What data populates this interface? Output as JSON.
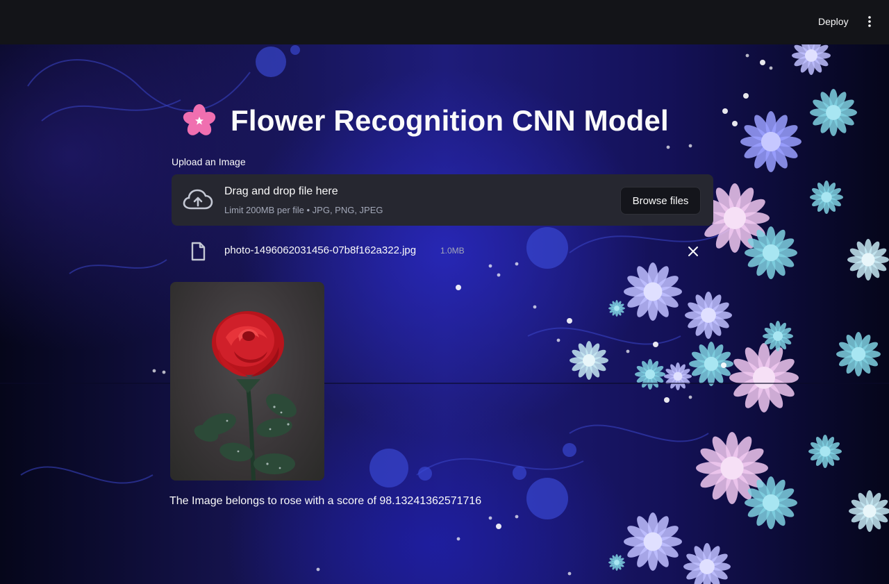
{
  "header": {
    "deploy_label": "Deploy",
    "menu_icon": "kebab-menu-icon"
  },
  "page": {
    "title_icon": "cherry-blossom-icon",
    "title": "Flower Recognition CNN Model"
  },
  "uploader": {
    "label": "Upload an Image",
    "icon": "cloud-upload-icon",
    "instruction": "Drag and drop file here",
    "limit_text": "Limit 200MB per file • JPG, PNG, JPEG",
    "browse_label": "Browse files"
  },
  "uploaded_file": {
    "icon": "file-icon",
    "name": "photo-1496062031456-07b8f162a322.jpg",
    "size": "1.0MB",
    "remove_icon": "close-icon"
  },
  "preview": {
    "subject": "red rose photograph"
  },
  "result": {
    "text": "The Image belongs to rose with a score of 98.13241362571716"
  },
  "colors": {
    "topbar": "#131418",
    "dropzone": "#262730",
    "text": "#fafafa",
    "muted": "#a3a8b8",
    "blossom_pink": "#f06fb0"
  }
}
